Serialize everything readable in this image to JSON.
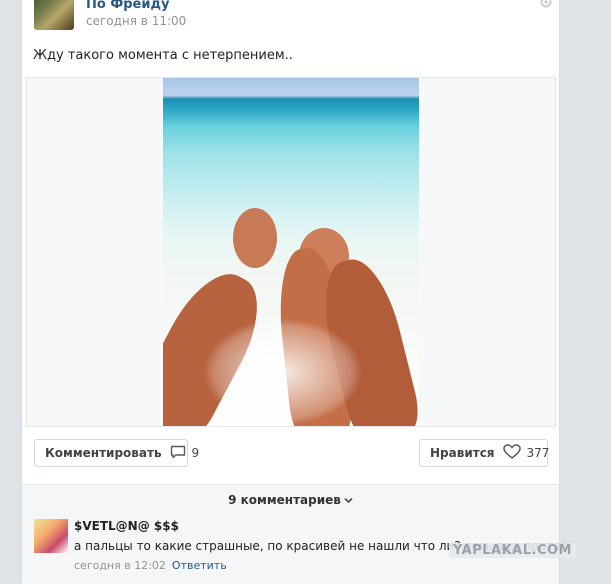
{
  "post": {
    "group_name": "По Фрейду",
    "time": "сегодня в 11:00",
    "text": "Жду такого момента с нетерпением.."
  },
  "actions": {
    "comment_label": "Комментировать",
    "comment_count": "9",
    "like_label": "Нравится",
    "like_count": "377"
  },
  "comments": {
    "toggle_label": "9 комментариев",
    "items": [
      {
        "author": "$VETL@N@ $$$",
        "text": "а пальцы то какие страшные, по красивей не нашли что ли? весь вид портят",
        "time": "сегодня в 12:02",
        "reply_label": "Ответить"
      }
    ]
  },
  "watermark": "YAPLAKAL.COM",
  "colors": {
    "link": "#2a5885",
    "muted": "#939393",
    "card_bg": "#ffffff",
    "page_bg": "#dfe3e8"
  },
  "icons": {
    "settings": "gear-icon",
    "comment": "speech-bubble-icon",
    "like": "heart-icon",
    "toggle": "chevron-down-icon"
  }
}
